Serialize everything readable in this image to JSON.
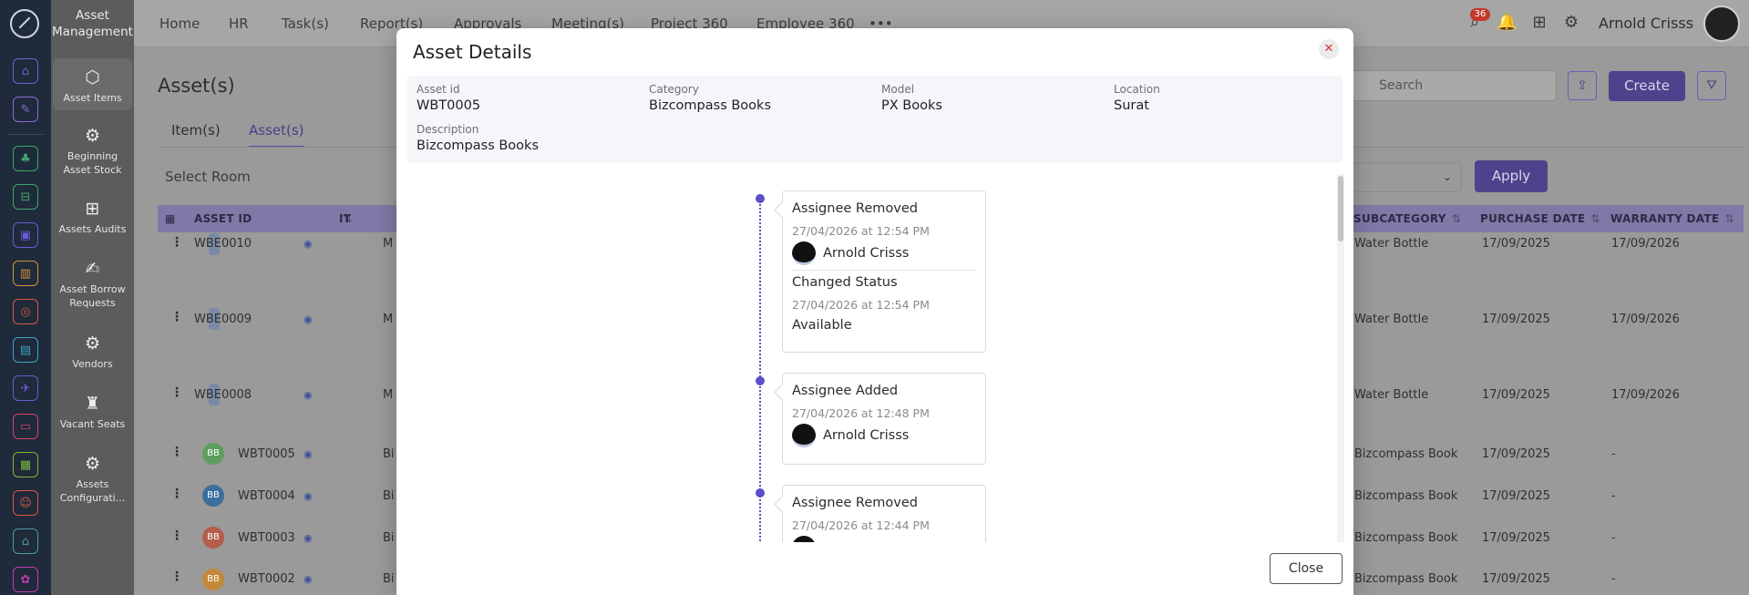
{
  "app": {
    "brand": "Asset Management",
    "user_name": "Arnold Crisss",
    "notification_count": "36"
  },
  "topnav": [
    "Home",
    "HR",
    "Task(s)",
    "Report(s)",
    "Approvals",
    "Meeting(s)",
    "Project 360",
    "Employee 360"
  ],
  "sidebar": [
    {
      "label": "Asset Items",
      "icon": "box-icon"
    },
    {
      "label": "Beginning Asset Stock",
      "icon": "gear-icon"
    },
    {
      "label": "Assets Audits",
      "icon": "audit-icon"
    },
    {
      "label": "Asset Borrow Requests",
      "icon": "borrow-icon"
    },
    {
      "label": "Vendors",
      "icon": "gear-icon"
    },
    {
      "label": "Vacant Seats",
      "icon": "seat-icon"
    },
    {
      "label": "Assets Configurati...",
      "icon": "gear-icon"
    }
  ],
  "page": {
    "title": "Asset(s)",
    "tabs": [
      "Item(s)",
      "Asset(s)"
    ],
    "room_select": "Select Room",
    "search_placeholder": "Search",
    "create_label": "Create",
    "apply_label": "Apply"
  },
  "table": {
    "headers": [
      "ASSET ID",
      "IT",
      "SUBCATEGORY",
      "PURCHASE DATE",
      "WARRANTY DATE"
    ],
    "rows": [
      {
        "id": "WBE0010",
        "item": "M",
        "subcategory": "Water Bottle",
        "purchase": "17/09/2025",
        "warranty": "17/09/2026",
        "avatar": "bottle"
      },
      {
        "id": "WBE0009",
        "item": "M",
        "subcategory": "Water Bottle",
        "purchase": "17/09/2025",
        "warranty": "17/09/2026",
        "avatar": "bottle"
      },
      {
        "id": "WBE0008",
        "item": "M",
        "subcategory": "Water Bottle",
        "purchase": "17/09/2025",
        "warranty": "17/09/2026",
        "avatar": "bottle"
      },
      {
        "id": "WBT0005",
        "item": "Bi",
        "subcategory": "Bizcompass Book",
        "purchase": "17/09/2025",
        "warranty": "-",
        "avatar": "BB",
        "color": "#5e9e5e"
      },
      {
        "id": "WBT0004",
        "item": "Bi",
        "subcategory": "Bizcompass Book",
        "purchase": "17/09/2025",
        "warranty": "-",
        "avatar": "BB",
        "color": "#3b6e9c"
      },
      {
        "id": "WBT0003",
        "item": "Bi",
        "subcategory": "Bizcompass Book",
        "purchase": "17/09/2025",
        "warranty": "-",
        "avatar": "BB",
        "color": "#b35e4a"
      },
      {
        "id": "WBT0002",
        "item": "Bi",
        "subcategory": "Bizcompass Book",
        "purchase": "17/09/2025",
        "warranty": "-",
        "avatar": "BB",
        "color": "#c4883a"
      }
    ]
  },
  "modal": {
    "title": "Asset Details",
    "close_label": "Close",
    "fields": {
      "asset_id_label": "Asset id",
      "asset_id": "WBT0005",
      "category_label": "Category",
      "category": "Bizcompass Books",
      "model_label": "Model",
      "model": "PX Books",
      "location_label": "Location",
      "location": "Surat",
      "description_label": "Description",
      "description": "Bizcompass Books"
    },
    "timeline": [
      {
        "title": "Assignee Removed",
        "time": "27/04/2026 at 12:54 PM",
        "user": "Arnold Crisss",
        "sub_title": "Changed Status",
        "sub_time": "27/04/2026 at 12:54 PM",
        "sub_value": "Available"
      },
      {
        "title": "Assignee Added",
        "time": "27/04/2026 at 12:48 PM",
        "user": "Arnold Crisss"
      },
      {
        "title": "Assignee Removed",
        "time": "27/04/2026 at 12:44 PM"
      }
    ]
  },
  "colors": {
    "accent": "#5a4fc8",
    "danger": "#d33"
  }
}
